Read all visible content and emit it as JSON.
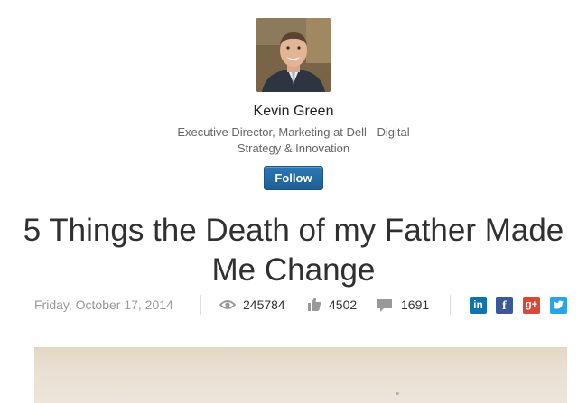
{
  "author": {
    "name": "Kevin Green",
    "headline": "Executive Director, Marketing at Dell - Digital Strategy & Innovation",
    "follow_label": "Follow"
  },
  "post": {
    "title": "5 Things the Death of my Father Made Me Change",
    "date": "Friday, October 17, 2014",
    "views": "245784",
    "likes": "4502",
    "comments": "1691"
  },
  "icons": {
    "views": "eye-icon",
    "likes": "thumbs-up-icon",
    "comments": "comment-bubble-icon"
  },
  "share": {
    "linkedin": "in",
    "facebook": "f",
    "googleplus": "g+"
  },
  "colors": {
    "follow_button": "#2d78b6",
    "linkedin": "#0f73b0",
    "facebook": "#3b5998",
    "googleplus": "#d84a38",
    "twitter": "#2aa4e6"
  }
}
